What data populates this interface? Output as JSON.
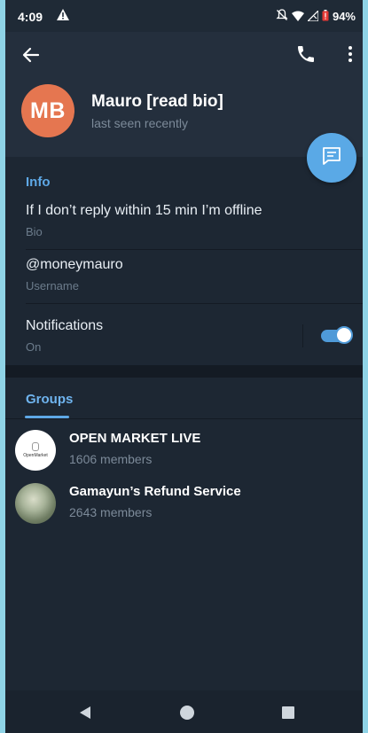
{
  "status": {
    "time": "4:09",
    "battery_pct": "94%"
  },
  "profile": {
    "initials": "MB",
    "name": "Mauro [read bio]",
    "last_seen": "last seen recently",
    "avatar_color": "#e57650"
  },
  "info": {
    "section_title": "Info",
    "bio_value": "If I don’t reply within 15 min I’m offline",
    "bio_label": "Bio",
    "username_value": "@moneymauro",
    "username_label": "Username",
    "notifications_label": "Notifications",
    "notifications_state": "On",
    "notifications_enabled": true
  },
  "groups": {
    "tab_label": "Groups",
    "items": [
      {
        "name": "OPEN MARKET LIVE",
        "members": "1606 members",
        "avatar_text": "OpenMarket"
      },
      {
        "name": "Gamayun’s Refund Service",
        "members": "2643 members"
      }
    ]
  },
  "colors": {
    "accent": "#5ea8e6",
    "background": "#1d2733",
    "header": "#242f3d"
  },
  "icons": {
    "back": "arrow-left-icon",
    "call": "phone-icon",
    "more": "more-vertical-icon",
    "fab": "message-icon"
  }
}
